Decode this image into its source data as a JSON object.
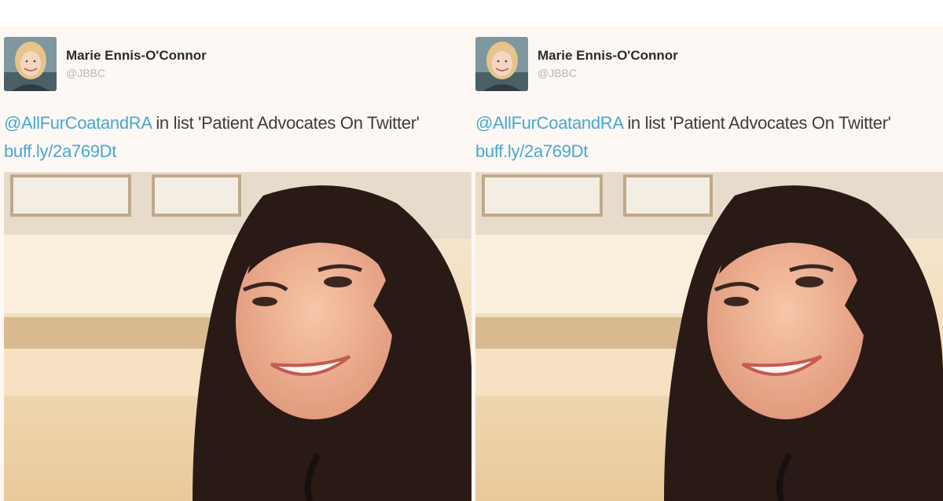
{
  "tweets": [
    {
      "author_name": "Marie Ennis-O'Connor",
      "author_handle": "@JBBC",
      "mention": "@AllFurCoatandRA",
      "text_rest": " in list 'Patient Advocates On Twitter'",
      "link": "buff.ly/2a769Dt",
      "avatar_icon": "profile-photo-avatar",
      "photo_icon": "selfie-photo"
    },
    {
      "author_name": "Marie Ennis-O'Connor",
      "author_handle": "@JBBC",
      "mention": "@AllFurCoatandRA",
      "text_rest": " in list 'Patient Advocates On Twitter'",
      "link": "buff.ly/2a769Dt",
      "avatar_icon": "profile-photo-avatar",
      "photo_icon": "selfie-photo"
    }
  ],
  "colors": {
    "mention_blue": "#47a7d1",
    "panel_bg": "#fdf8f4",
    "name_text": "#2b2b2b",
    "handle_text": "#b9b5b2"
  }
}
